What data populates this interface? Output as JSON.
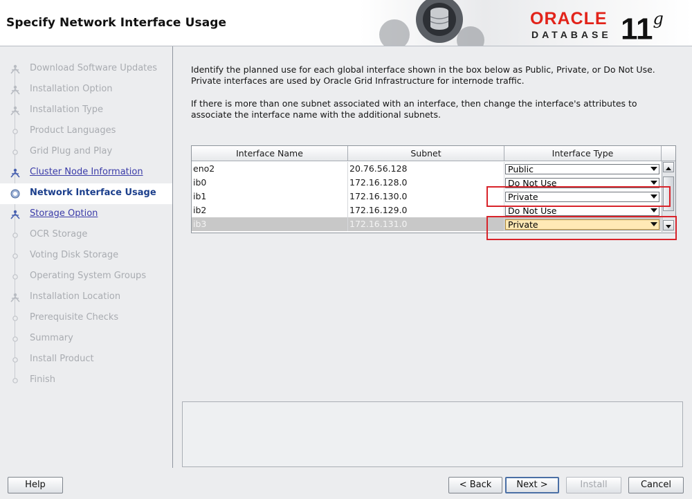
{
  "header": {
    "title": "Specify Network Interface Usage",
    "logo_word": "ORACLE",
    "logo_sub": "DATABASE",
    "version_num": "11",
    "version_letter": "g",
    "brand_color": "#e2231a"
  },
  "sidebar": {
    "items": [
      {
        "label": "Download Software Updates",
        "state": "done"
      },
      {
        "label": "Installation Option",
        "state": "done"
      },
      {
        "label": "Installation Type",
        "state": "done"
      },
      {
        "label": "Product Languages",
        "state": "pending"
      },
      {
        "label": "Grid Plug and Play",
        "state": "pending"
      },
      {
        "label": "Cluster Node Information",
        "state": "link"
      },
      {
        "label": "Network Interface Usage",
        "state": "current"
      },
      {
        "label": "Storage Option",
        "state": "link"
      },
      {
        "label": "OCR Storage",
        "state": "pending"
      },
      {
        "label": "Voting Disk Storage",
        "state": "pending"
      },
      {
        "label": "Operating System Groups",
        "state": "pending"
      },
      {
        "label": "Installation Location",
        "state": "done"
      },
      {
        "label": "Prerequisite Checks",
        "state": "pending"
      },
      {
        "label": "Summary",
        "state": "pending"
      },
      {
        "label": "Install Product",
        "state": "pending"
      },
      {
        "label": "Finish",
        "state": "pending"
      }
    ]
  },
  "main": {
    "instruction1": "Identify the planned use for each global interface shown in the box below as Public, Private, or Do Not Use. Private interfaces are used by Oracle Grid Infrastructure for internode traffic.",
    "instruction2": "If there is more than one subnet associated with an interface, then change the interface's attributes to associate the interface name with the additional subnets.",
    "table": {
      "headers": [
        "Interface Name",
        "Subnet",
        "Interface Type"
      ],
      "rows": [
        {
          "name": "eno2",
          "subnet": "20.76.56.128",
          "type": "Public"
        },
        {
          "name": "ib0",
          "subnet": "172.16.128.0",
          "type": "Do Not Use"
        },
        {
          "name": "ib1",
          "subnet": "172.16.130.0",
          "type": "Private"
        },
        {
          "name": "ib2",
          "subnet": "172.16.129.0",
          "type": "Do Not Use"
        },
        {
          "name": "ib3",
          "subnet": "172.16.131.0",
          "type": "Private"
        }
      ]
    }
  },
  "buttons": {
    "help": "Help",
    "back": "< Back",
    "next": "Next >",
    "install": "Install",
    "cancel": "Cancel"
  }
}
